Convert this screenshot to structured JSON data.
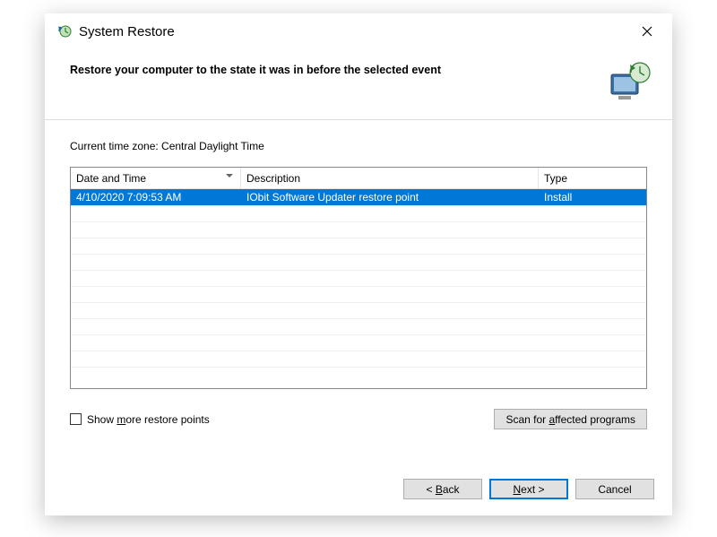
{
  "titlebar": {
    "title": "System Restore",
    "close_icon": "close-icon"
  },
  "header": {
    "text": "Restore your computer to the state it was in before the selected event",
    "icon": "restore-illustration"
  },
  "timezone_label_prefix": "Current time zone: ",
  "timezone_value": "Central Daylight Time",
  "table": {
    "columns": {
      "date_time": "Date and Time",
      "description": "Description",
      "type": "Type"
    },
    "sort_indicator_on": "date_time",
    "rows": [
      {
        "date_time": "4/10/2020 7:09:53 AM",
        "description": "IObit Software Updater restore point",
        "type": "Install",
        "selected": true
      }
    ]
  },
  "show_more_checkbox": {
    "label_pre": "Show ",
    "accel": "m",
    "label_post": "ore restore points",
    "checked": false
  },
  "scan_button": {
    "label_pre": "Scan for ",
    "accel": "a",
    "label_post": "ffected programs"
  },
  "footer": {
    "back": {
      "lt": "< ",
      "accel": "B",
      "post": "ack"
    },
    "next": {
      "accel": "N",
      "post": "ext >"
    },
    "cancel": "Cancel"
  }
}
